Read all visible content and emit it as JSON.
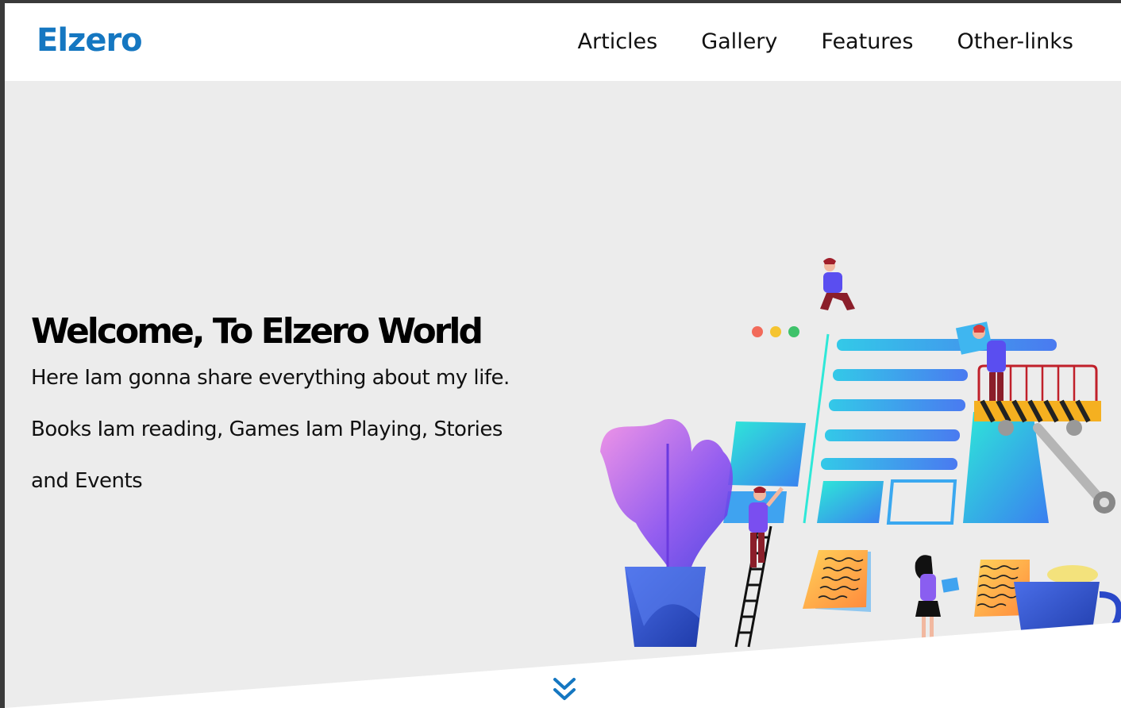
{
  "header": {
    "logo": "Elzero",
    "nav": [
      "Articles",
      "Gallery",
      "Features",
      "Other-links"
    ]
  },
  "hero": {
    "title": "Welcome, To Elzero World",
    "description": "Here Iam gonna share everything about my life. Books Iam reading, Games Iam Playing, Stories and Events"
  },
  "icons": {
    "scroll_down": "double-chevron-down-icon",
    "illustration": "team-building-website-illustration"
  },
  "colors": {
    "brand": "#1577c1",
    "hero_bg": "#ececec",
    "header_bg": "#ffffff"
  }
}
